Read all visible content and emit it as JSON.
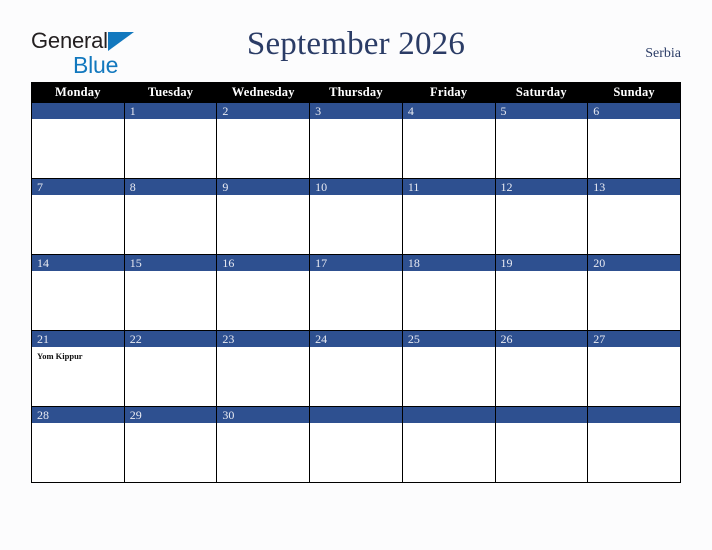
{
  "brand": {
    "line1": "General",
    "line2": "Blue",
    "triangle_color": "#1278be",
    "text_color": "#231f20"
  },
  "header": {
    "title": "September 2026",
    "country": "Serbia",
    "title_color": "#2b3c66"
  },
  "calendar": {
    "weekday_headers": [
      "Monday",
      "Tuesday",
      "Wednesday",
      "Thursday",
      "Friday",
      "Saturday",
      "Sunday"
    ],
    "header_bg": "#000000",
    "header_text": "#ffffff",
    "daybar_bg": "#2e5090",
    "daybar_text": "#e8eaf2",
    "cell_bg": "#ffffff",
    "weeks": [
      [
        {
          "day": "",
          "events": []
        },
        {
          "day": "1",
          "events": []
        },
        {
          "day": "2",
          "events": []
        },
        {
          "day": "3",
          "events": []
        },
        {
          "day": "4",
          "events": []
        },
        {
          "day": "5",
          "events": []
        },
        {
          "day": "6",
          "events": []
        }
      ],
      [
        {
          "day": "7",
          "events": []
        },
        {
          "day": "8",
          "events": []
        },
        {
          "day": "9",
          "events": []
        },
        {
          "day": "10",
          "events": []
        },
        {
          "day": "11",
          "events": []
        },
        {
          "day": "12",
          "events": []
        },
        {
          "day": "13",
          "events": []
        }
      ],
      [
        {
          "day": "14",
          "events": []
        },
        {
          "day": "15",
          "events": []
        },
        {
          "day": "16",
          "events": []
        },
        {
          "day": "17",
          "events": []
        },
        {
          "day": "18",
          "events": []
        },
        {
          "day": "19",
          "events": []
        },
        {
          "day": "20",
          "events": []
        }
      ],
      [
        {
          "day": "21",
          "events": [
            "Yom Kippur"
          ]
        },
        {
          "day": "22",
          "events": []
        },
        {
          "day": "23",
          "events": []
        },
        {
          "day": "24",
          "events": []
        },
        {
          "day": "25",
          "events": []
        },
        {
          "day": "26",
          "events": []
        },
        {
          "day": "27",
          "events": []
        }
      ],
      [
        {
          "day": "28",
          "events": []
        },
        {
          "day": "29",
          "events": []
        },
        {
          "day": "30",
          "events": []
        },
        {
          "day": "",
          "events": []
        },
        {
          "day": "",
          "events": []
        },
        {
          "day": "",
          "events": []
        },
        {
          "day": "",
          "events": []
        }
      ]
    ]
  }
}
